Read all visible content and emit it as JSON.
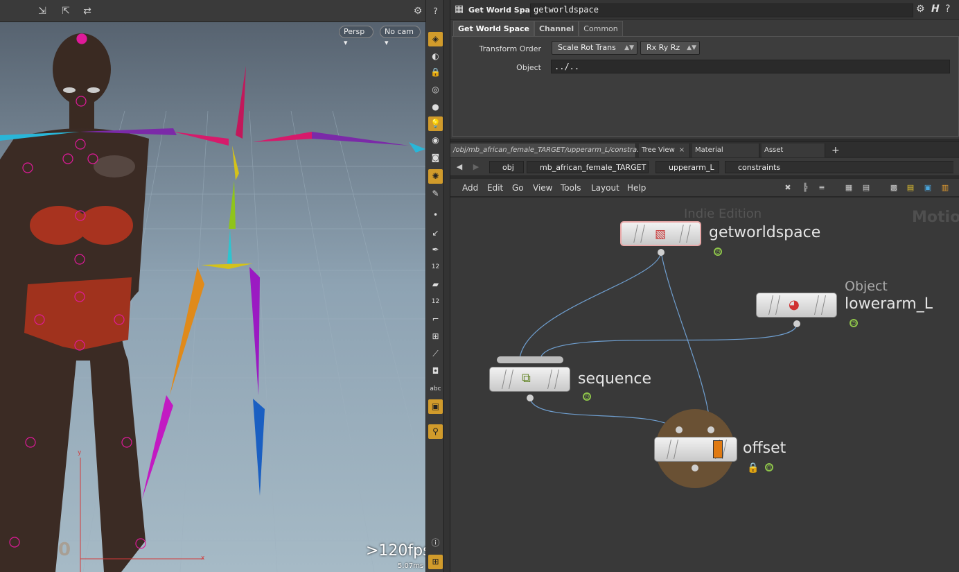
{
  "viewport": {
    "tools": [
      "select-tool",
      "move-tool",
      "transform-tool"
    ],
    "camera_view": "Persp",
    "camera_select": "No cam",
    "fps": ">120fps",
    "frame_ms": "5.07ms",
    "axis_y": "y",
    "axis_x": "x",
    "ground_num": "0"
  },
  "viewport_toolbar": {
    "icons": [
      "ghost-icon",
      "display-icon",
      "lock-icon",
      "snap-icon",
      "shading-icon",
      "light-icon",
      "visibility-icon",
      "camera-icon",
      "bulb-icon",
      "brush-icon",
      "dot-icon",
      "edge-icon",
      "pen-icon",
      "number-12-icon",
      "fill-icon",
      "number-12b-icon",
      "curve-icon",
      "grid-icon",
      "bone-icon",
      "square-icon",
      "abc-icon",
      "background-icon",
      "pin-icon",
      "info-icon",
      "layout-icon"
    ],
    "number_label": "12",
    "abc_label": "abc"
  },
  "params": {
    "node_type": "Get World Space",
    "node_name": "getworldspace",
    "tabs": [
      "Get World Space",
      "Channel",
      "Common"
    ],
    "active_tab": "Get World Space",
    "transform_order_label": "Transform Order",
    "transform_order_value": "Scale Rot Trans",
    "rotate_order_value": "Rx Ry Rz",
    "object_label": "Object",
    "object_value": "../.."
  },
  "network_tabs": [
    {
      "label": "/obj/mb_african_female_TARGET/upperarm_L/constra...",
      "active": true
    },
    {
      "label": "Tree View",
      "active": false
    },
    {
      "label": "Material Palette",
      "active": false
    },
    {
      "label": "Asset Browser",
      "active": false
    }
  ],
  "add_tab": "+",
  "breadcrumbs": [
    "obj",
    "mb_african_female_TARGET",
    "upperarm_L",
    "constraints"
  ],
  "network_menu": [
    "Add",
    "Edit",
    "Go",
    "View",
    "Tools",
    "Layout",
    "Help"
  ],
  "network": {
    "watermark_edition": "Indie Edition",
    "watermark_context": "Motion",
    "nodes": [
      {
        "name": "getworldspace",
        "subtitle": ""
      },
      {
        "name": "lowerarm_L",
        "subtitle": "Object"
      },
      {
        "name": "sequence",
        "subtitle": ""
      },
      {
        "name": "offset",
        "subtitle": ""
      }
    ]
  },
  "colors": {
    "accent": "#d19b2b",
    "flag_green": "#8ec44a",
    "wire": "#6f9fd0",
    "offset_highlight": "#e07a12"
  }
}
